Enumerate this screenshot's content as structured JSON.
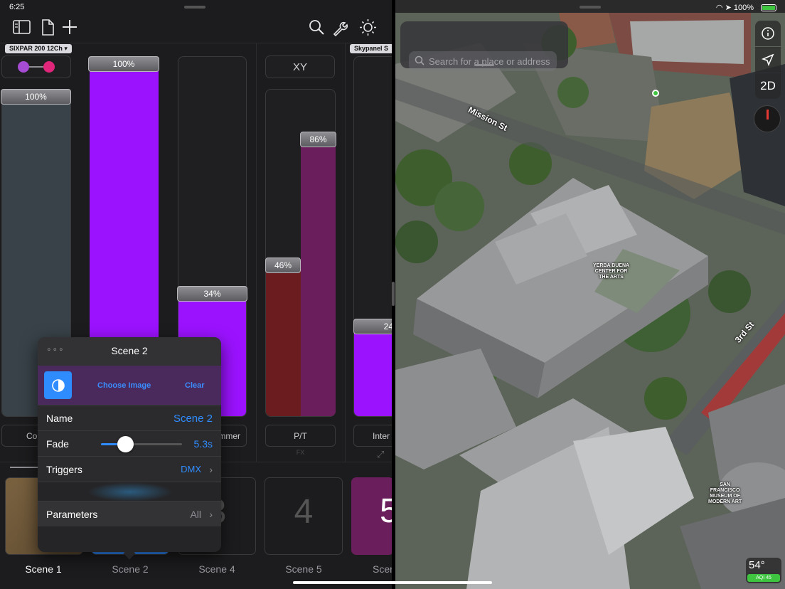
{
  "status_bar": {
    "time": "6:25",
    "battery": "100%"
  },
  "toolbar": {
    "sidebar_icon": "sidebar-icon",
    "document_icon": "document-icon",
    "add_icon": "plus-icon",
    "search_icon": "search-icon",
    "tools_icon": "wrench-icon",
    "brightness_icon": "sun-icon"
  },
  "fixtures": {
    "primary": "SIXPAR 200 12Ch",
    "secondary": "Skypanel S"
  },
  "colors": {
    "accent_purple": "#9b12ff",
    "dark_purple": "#6a1f5c",
    "dark_red": "#6b1c1e",
    "slate": "#384248",
    "blue": "#2f8cff",
    "dot_1": "#a64bd3",
    "dot_2": "#e0267a"
  },
  "faders": {
    "color": {
      "level_label": "100%",
      "level": 1.0,
      "label": "Col"
    },
    "intensity": {
      "level_label": "100%",
      "level": 1.0
    },
    "dimmer": {
      "level_label": "34%",
      "level": 0.34,
      "label": "mmer"
    },
    "pan": {
      "level_label": "46%",
      "level": 0.46
    },
    "tilt": {
      "level_label": "86%",
      "level": 0.86
    },
    "pt": {
      "header": "XY",
      "label": "P/T",
      "sub_label": "FX"
    },
    "inter": {
      "level_label": "24",
      "level": 0.24,
      "label": "Inter"
    }
  },
  "scenes": [
    {
      "label": "Scene 1",
      "active": true
    },
    {
      "label": "Scene 2",
      "number": ""
    },
    {
      "label": "Scene 4",
      "number": "3"
    },
    {
      "label": "Scene 5",
      "number": "4"
    },
    {
      "label": "Scen",
      "number": "5"
    }
  ],
  "popover": {
    "menu_icon": "ellipsis-icon",
    "title": "Scene 2",
    "image_icon": "contrast-icon",
    "choose_image": "Choose Image",
    "clear": "Clear",
    "name_label": "Name",
    "name_value": "Scene 2",
    "fade_label": "Fade",
    "fade_value": "5.3s",
    "fade_level": 0.3,
    "triggers_label": "Triggers",
    "triggers_value": "DMX",
    "parameters_label": "Parameters",
    "parameters_value": "All"
  },
  "map": {
    "search_placeholder": "Search for a place or address",
    "info_icon": "info-icon",
    "location_icon": "location-arrow-icon",
    "view_mode": "2D",
    "compass_icon": "compass-icon",
    "street_mission": "Mission St",
    "street_3rd": "3rd St",
    "poi_yerba": "YERBA BUENA\nCENTER FOR\nTHE ARTS",
    "poi_sfmoma": "SAN\nFRANCISCO\nMUSEUM OF\nMODERN ART",
    "weather_temp": "54°",
    "weather_aqi": "AQI 45"
  }
}
